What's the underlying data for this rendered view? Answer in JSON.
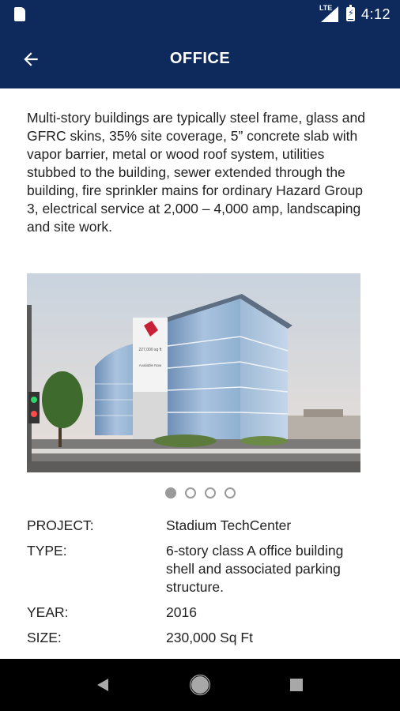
{
  "status_bar": {
    "network": "LTE",
    "time": "4:12",
    "icons": [
      "sd-card-icon",
      "signal-icon",
      "battery-charging-icon"
    ]
  },
  "app_bar": {
    "title": "OFFICE",
    "back_icon": "arrow-left-icon"
  },
  "description": "Multi-story buildings are typically steel frame, glass and GFRC skins, 35% site coverage, 5” concrete slab with vapor barrier, metal or wood roof system, utilities stubbed to the building, sewer extended through the building, fire sprinkler mains for ordinary Hazard Group 3, electrical service at 2,000 – 4,000 amp, landscaping and site work.",
  "gallery": {
    "image_alt": "Stadium TechCenter office building",
    "sign_text": "227,000 sq ft",
    "sign_sub": "Available Now",
    "page_count": 4,
    "active_index": 0
  },
  "project": {
    "project_label": "PROJECT:",
    "project_value": "Stadium TechCenter",
    "type_label": "TYPE:",
    "type_value": "6-story class A office building shell and associated parking structure.",
    "year_label": "YEAR:",
    "year_value": "2016",
    "size_label": "SIZE:",
    "size_value": "230,000 Sq Ft"
  },
  "nav_bar": {
    "back_icon": "nav-back-triangle-icon",
    "home_icon": "nav-home-circle-icon",
    "recents_icon": "nav-recents-square-icon"
  },
  "colors": {
    "primary": "#0e2a5c",
    "text": "#222222",
    "dot": "#9a9a9a"
  }
}
